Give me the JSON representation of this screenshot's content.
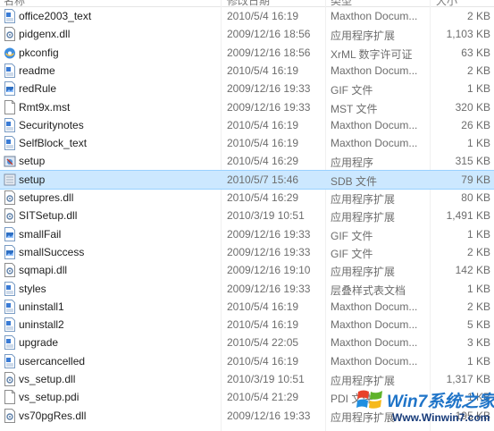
{
  "header": {
    "columns": [
      "名称",
      "修改日期",
      "类型",
      "大小"
    ]
  },
  "rows": [
    {
      "name": "office2003_text",
      "date": "2010/5/4 16:19",
      "type": "Maxthon Docum...",
      "size": "2 KB",
      "icon": "document-icon"
    },
    {
      "name": "pidgenx.dll",
      "date": "2009/12/16 18:56",
      "type": "应用程序扩展",
      "size": "1,103 KB",
      "icon": "dll-file-icon"
    },
    {
      "name": "pkconfig",
      "date": "2009/12/16 18:56",
      "type": "XrML 数字许可证",
      "size": "63 KB",
      "icon": "browser-file-icon"
    },
    {
      "name": "readme",
      "date": "2010/5/4 16:19",
      "type": "Maxthon Docum...",
      "size": "2 KB",
      "icon": "document-icon"
    },
    {
      "name": "redRule",
      "date": "2009/12/16 19:33",
      "type": "GIF 文件",
      "size": "1 KB",
      "icon": "image-file-icon"
    },
    {
      "name": "Rmt9x.mst",
      "date": "2009/12/16 19:33",
      "type": "MST 文件",
      "size": "320 KB",
      "icon": "blank-file-icon"
    },
    {
      "name": "Securitynotes",
      "date": "2010/5/4 16:19",
      "type": "Maxthon Docum...",
      "size": "26 KB",
      "icon": "document-icon"
    },
    {
      "name": "SelfBlock_text",
      "date": "2010/5/4 16:19",
      "type": "Maxthon Docum...",
      "size": "1 KB",
      "icon": "document-icon"
    },
    {
      "name": "setup",
      "date": "2010/5/4 16:29",
      "type": "应用程序",
      "size": "315 KB",
      "icon": "setup-exe-icon"
    },
    {
      "name": "setup",
      "date": "2010/5/7 15:46",
      "type": "SDB 文件",
      "size": "79 KB",
      "icon": "sdb-file-icon",
      "selected": true
    },
    {
      "name": "setupres.dll",
      "date": "2010/5/4 16:29",
      "type": "应用程序扩展",
      "size": "80 KB",
      "icon": "dll-file-icon"
    },
    {
      "name": "SITSetup.dll",
      "date": "2010/3/19 10:51",
      "type": "应用程序扩展",
      "size": "1,491 KB",
      "icon": "dll-file-icon"
    },
    {
      "name": "smallFail",
      "date": "2009/12/16 19:33",
      "type": "GIF 文件",
      "size": "1 KB",
      "icon": "image-file-icon"
    },
    {
      "name": "smallSuccess",
      "date": "2009/12/16 19:33",
      "type": "GIF 文件",
      "size": "2 KB",
      "icon": "image-file-icon"
    },
    {
      "name": "sqmapi.dll",
      "date": "2009/12/16 19:10",
      "type": "应用程序扩展",
      "size": "142 KB",
      "icon": "dll-file-icon"
    },
    {
      "name": "styles",
      "date": "2009/12/16 19:33",
      "type": "层叠样式表文档",
      "size": "1 KB",
      "icon": "document-icon"
    },
    {
      "name": "uninstall1",
      "date": "2010/5/4 16:19",
      "type": "Maxthon Docum...",
      "size": "2 KB",
      "icon": "document-icon"
    },
    {
      "name": "uninstall2",
      "date": "2010/5/4 16:19",
      "type": "Maxthon Docum...",
      "size": "5 KB",
      "icon": "document-icon"
    },
    {
      "name": "upgrade",
      "date": "2010/5/4 22:05",
      "type": "Maxthon Docum...",
      "size": "3 KB",
      "icon": "document-icon"
    },
    {
      "name": "usercancelled",
      "date": "2010/5/4 16:19",
      "type": "Maxthon Docum...",
      "size": "1 KB",
      "icon": "document-icon"
    },
    {
      "name": "vs_setup.dll",
      "date": "2010/3/19 10:51",
      "type": "应用程序扩展",
      "size": "1,317 KB",
      "icon": "dll-file-icon"
    },
    {
      "name": "vs_setup.pdi",
      "date": "2010/5/4 21:29",
      "type": "PDI 文件",
      "size": "1 KB",
      "icon": "blank-file-icon"
    },
    {
      "name": "vs70pgRes.dll",
      "date": "2009/12/16 19:33",
      "type": "应用程序扩展",
      "size": "195 KB",
      "icon": "dll-file-icon"
    }
  ],
  "watermark": {
    "title": "Win7系统之家",
    "url": "Www.Winwin7.com"
  }
}
